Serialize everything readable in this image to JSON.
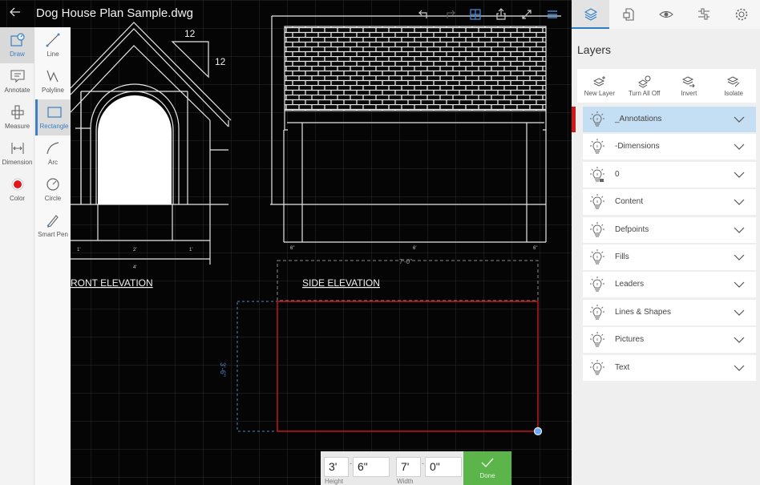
{
  "header": {
    "back_icon": "back-arrow-icon",
    "title": "Dog House Plan Sample.dwg",
    "actions": [
      {
        "name": "undo",
        "icon": "undo-icon"
      },
      {
        "name": "redo",
        "icon": "redo-icon"
      },
      {
        "name": "grid",
        "icon": "grid-icon"
      },
      {
        "name": "share",
        "icon": "share-icon"
      },
      {
        "name": "fullscreen",
        "icon": "expand-icon"
      },
      {
        "name": "menu",
        "icon": "hamburger-icon"
      }
    ]
  },
  "tools": {
    "primary": [
      {
        "label": "Draw",
        "icon": "draw-icon",
        "active": true
      },
      {
        "label": "Annotate",
        "icon": "annotate-icon"
      },
      {
        "label": "Measure",
        "icon": "measure-icon"
      },
      {
        "label": "Dimension",
        "icon": "dimension-icon"
      },
      {
        "label": "Color",
        "icon": "color-icon"
      }
    ],
    "secondary": [
      {
        "label": "Line",
        "icon": "line-icon"
      },
      {
        "label": "Polyline",
        "icon": "polyline-icon"
      },
      {
        "label": "Rectangle",
        "icon": "rectangle-icon",
        "selected": true
      },
      {
        "label": "Arc",
        "icon": "arc-icon"
      },
      {
        "label": "Circle",
        "icon": "circle-icon"
      },
      {
        "label": "Smart Pen",
        "icon": "smart-pen-icon"
      }
    ]
  },
  "drawing": {
    "front_title": "RONT ELEVATION",
    "side_title": "SIDE ELEVATION",
    "slope_run": "12",
    "slope_rise": "12",
    "front_dims": [
      "1'",
      "2'",
      "1'",
      "4'"
    ],
    "side_dims": [
      "6\"",
      "6'",
      "6\""
    ],
    "preview_width_label": "7'-0\"",
    "preview_height_label": "3'-6\"",
    "preview_stroke_color": "#c0161a",
    "guide_color": "#4a87c7"
  },
  "dimension_input": {
    "height_feet": "3'",
    "height_inches": "6\"",
    "width_feet": "7'",
    "width_inches": "0\"",
    "separator": "-",
    "height_label": "Height",
    "width_label": "Width",
    "done_label": "Done"
  },
  "right_panel": {
    "tabs": [
      {
        "name": "layers",
        "icon": "layers-icon",
        "active": true
      },
      {
        "name": "blocks",
        "icon": "blocks-icon"
      },
      {
        "name": "view",
        "icon": "eye-icon"
      },
      {
        "name": "properties",
        "icon": "sliders-icon"
      },
      {
        "name": "settings",
        "icon": "gear-icon"
      }
    ],
    "title": "Layers",
    "actions": [
      {
        "label": "New Layer",
        "icon": "new-layer-icon"
      },
      {
        "label": "Turn All Off",
        "icon": "turn-all-off-icon"
      },
      {
        "label": "Invert",
        "icon": "invert-icon"
      },
      {
        "label": "Isolate",
        "icon": "isolate-icon"
      }
    ],
    "layers": [
      {
        "name": "_Annotations",
        "active": true
      },
      {
        "name": "-Dimensions"
      },
      {
        "name": "0",
        "locked": true
      },
      {
        "name": "Content"
      },
      {
        "name": "Defpoints"
      },
      {
        "name": "Fills"
      },
      {
        "name": "Leaders"
      },
      {
        "name": "Lines & Shapes"
      },
      {
        "name": "Pictures"
      },
      {
        "name": "Text"
      }
    ],
    "accent_color": "#2f7ec4",
    "active_marker_color": "#d0191b"
  }
}
